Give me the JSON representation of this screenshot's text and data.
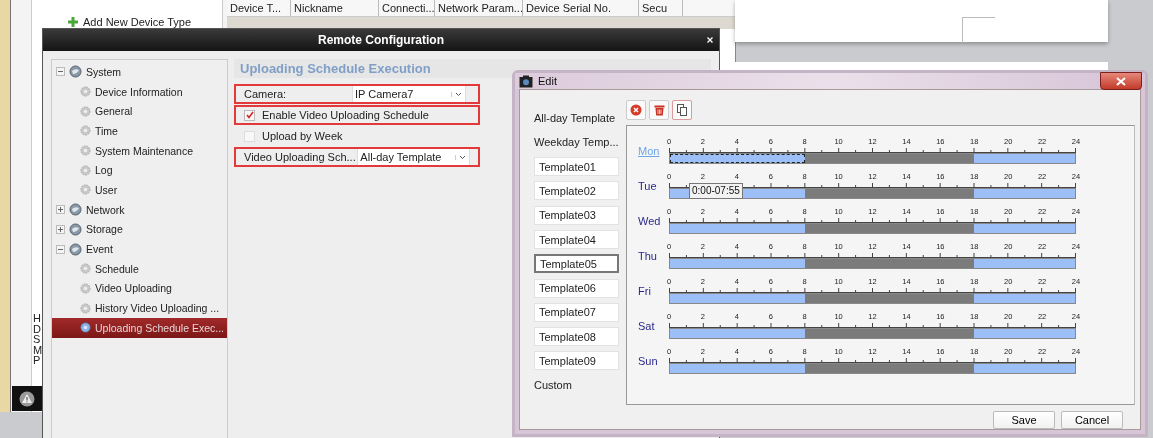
{
  "background_app": {
    "sidebar_items": [
      "Add New Device Type"
    ],
    "table_columns": [
      "Device T...",
      "Nickname",
      "Connecti...",
      "Network Param...",
      "Device Serial No.",
      "Secu"
    ],
    "side_letters": [
      "H",
      "D",
      "S",
      "M",
      "P"
    ]
  },
  "remote_configuration": {
    "title": "Remote Configuration",
    "tree": [
      {
        "label": "System",
        "expanded": true,
        "selected": false,
        "children": [
          {
            "label": "Device Information",
            "selected": false
          },
          {
            "label": "General",
            "selected": false
          },
          {
            "label": "Time",
            "selected": false
          },
          {
            "label": "System Maintenance",
            "selected": false
          },
          {
            "label": "Log",
            "selected": false
          },
          {
            "label": "User",
            "selected": false
          }
        ]
      },
      {
        "label": "Network",
        "expanded": false,
        "selected": false
      },
      {
        "label": "Storage",
        "expanded": false,
        "selected": false
      },
      {
        "label": "Event",
        "expanded": true,
        "selected": false,
        "children": [
          {
            "label": "Schedule",
            "selected": false
          },
          {
            "label": "Video Uploading",
            "selected": false
          },
          {
            "label": "History Video Uploading ...",
            "selected": false
          },
          {
            "label": "Uploading Schedule Exec...",
            "selected": true
          }
        ]
      }
    ],
    "section_title": "Uploading Schedule Execution",
    "form": [
      {
        "kind": "select",
        "label": "Camera:",
        "value": "IP Camera7",
        "highlighted": true
      },
      {
        "kind": "checkbox",
        "label": "Enable Video Uploading Schedule",
        "checked": true,
        "highlighted": true
      },
      {
        "kind": "checkbox",
        "label": "Upload by Week",
        "checked": false,
        "highlighted": false
      },
      {
        "kind": "select",
        "label": "Video Uploading Sch...",
        "value": "All-day Template",
        "highlighted": true
      }
    ]
  },
  "edit_dialog": {
    "title": "Edit",
    "templates": [
      {
        "kind": "header",
        "label": "All-day Template",
        "selected": false
      },
      {
        "kind": "header",
        "label": "Weekday Temp...",
        "selected": false
      },
      {
        "kind": "template",
        "label": "Template01",
        "selected": false
      },
      {
        "kind": "template",
        "label": "Template02",
        "selected": false
      },
      {
        "kind": "template",
        "label": "Template03",
        "selected": false
      },
      {
        "kind": "template",
        "label": "Template04",
        "selected": false
      },
      {
        "kind": "template",
        "label": "Template05",
        "selected": true
      },
      {
        "kind": "template",
        "label": "Template06",
        "selected": false
      },
      {
        "kind": "template",
        "label": "Template07",
        "selected": false
      },
      {
        "kind": "template",
        "label": "Template08",
        "selected": false
      },
      {
        "kind": "template",
        "label": "Template09",
        "selected": false
      },
      {
        "kind": "header",
        "label": "Custom",
        "selected": false
      }
    ],
    "days": [
      {
        "label": "Mon",
        "selected": true,
        "ticks": [
          "0",
          "2",
          "4",
          "6",
          "8",
          "10",
          "12",
          "14",
          "16",
          "18",
          "20",
          "22",
          "24"
        ],
        "segments": [
          {
            "kind": "normal",
            "selected": true
          },
          {
            "kind": "event",
            "selected": false
          },
          {
            "kind": "normal",
            "selected": false
          }
        ],
        "tooltip": "0:00-07:55"
      },
      {
        "label": "Tue",
        "selected": false,
        "ticks": [
          "0",
          "2",
          "4",
          "6",
          "8",
          "10",
          "12",
          "14",
          "16",
          "18",
          "20",
          "22",
          "24"
        ],
        "segments": [
          {
            "kind": "normal",
            "selected": false
          },
          {
            "kind": "event",
            "selected": false
          },
          {
            "kind": "normal",
            "selected": false
          }
        ]
      },
      {
        "label": "Wed",
        "selected": false,
        "ticks": [
          "0",
          "2",
          "4",
          "6",
          "8",
          "10",
          "12",
          "14",
          "16",
          "18",
          "20",
          "22",
          "24"
        ],
        "segments": [
          {
            "kind": "normal",
            "selected": false
          },
          {
            "kind": "event",
            "selected": false
          },
          {
            "kind": "normal",
            "selected": false
          }
        ]
      },
      {
        "label": "Thu",
        "selected": false,
        "ticks": [
          "0",
          "2",
          "4",
          "6",
          "8",
          "10",
          "12",
          "14",
          "16",
          "18",
          "20",
          "22",
          "24"
        ],
        "segments": [
          {
            "kind": "normal",
            "selected": false
          },
          {
            "kind": "event",
            "selected": false
          },
          {
            "kind": "normal",
            "selected": false
          }
        ]
      },
      {
        "label": "Fri",
        "selected": false,
        "ticks": [
          "0",
          "2",
          "4",
          "6",
          "8",
          "10",
          "12",
          "14",
          "16",
          "18",
          "20",
          "22",
          "24"
        ],
        "segments": [
          {
            "kind": "normal",
            "selected": false
          },
          {
            "kind": "event",
            "selected": false
          },
          {
            "kind": "normal",
            "selected": false
          }
        ]
      },
      {
        "label": "Sat",
        "selected": false,
        "ticks": [
          "0",
          "2",
          "4",
          "6",
          "8",
          "10",
          "12",
          "14",
          "16",
          "18",
          "20",
          "22",
          "24"
        ],
        "segments": [
          {
            "kind": "normal",
            "selected": false
          },
          {
            "kind": "event",
            "selected": false
          },
          {
            "kind": "normal",
            "selected": false
          }
        ]
      },
      {
        "label": "Sun",
        "selected": false,
        "ticks": [
          "0",
          "2",
          "4",
          "6",
          "8",
          "10",
          "12",
          "14",
          "16",
          "18",
          "20",
          "22",
          "24"
        ],
        "segments": [
          {
            "kind": "normal",
            "selected": false
          },
          {
            "kind": "event",
            "selected": false
          },
          {
            "kind": "normal",
            "selected": false
          }
        ]
      }
    ],
    "buttons": [
      "Save",
      "Cancel"
    ]
  }
}
